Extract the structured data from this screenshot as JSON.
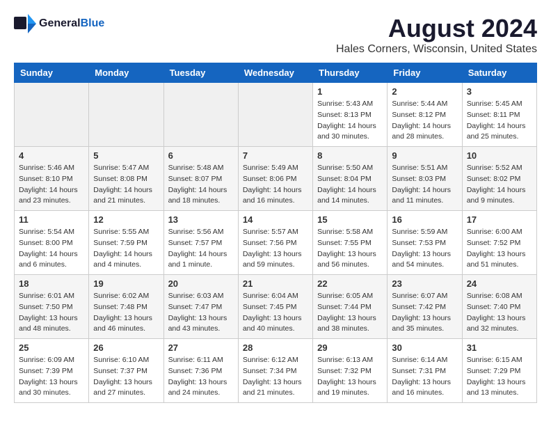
{
  "header": {
    "logo_general": "General",
    "logo_blue": "Blue",
    "month_year": "August 2024",
    "location": "Hales Corners, Wisconsin, United States"
  },
  "columns": [
    "Sunday",
    "Monday",
    "Tuesday",
    "Wednesday",
    "Thursday",
    "Friday",
    "Saturday"
  ],
  "weeks": [
    [
      {
        "empty": true
      },
      {
        "empty": true
      },
      {
        "empty": true
      },
      {
        "empty": true
      },
      {
        "day": "1",
        "sunrise": "5:43 AM",
        "sunset": "8:13 PM",
        "daylight": "14 hours and 30 minutes."
      },
      {
        "day": "2",
        "sunrise": "5:44 AM",
        "sunset": "8:12 PM",
        "daylight": "14 hours and 28 minutes."
      },
      {
        "day": "3",
        "sunrise": "5:45 AM",
        "sunset": "8:11 PM",
        "daylight": "14 hours and 25 minutes."
      }
    ],
    [
      {
        "day": "4",
        "sunrise": "5:46 AM",
        "sunset": "8:10 PM",
        "daylight": "14 hours and 23 minutes."
      },
      {
        "day": "5",
        "sunrise": "5:47 AM",
        "sunset": "8:08 PM",
        "daylight": "14 hours and 21 minutes."
      },
      {
        "day": "6",
        "sunrise": "5:48 AM",
        "sunset": "8:07 PM",
        "daylight": "14 hours and 18 minutes."
      },
      {
        "day": "7",
        "sunrise": "5:49 AM",
        "sunset": "8:06 PM",
        "daylight": "14 hours and 16 minutes."
      },
      {
        "day": "8",
        "sunrise": "5:50 AM",
        "sunset": "8:04 PM",
        "daylight": "14 hours and 14 minutes."
      },
      {
        "day": "9",
        "sunrise": "5:51 AM",
        "sunset": "8:03 PM",
        "daylight": "14 hours and 11 minutes."
      },
      {
        "day": "10",
        "sunrise": "5:52 AM",
        "sunset": "8:02 PM",
        "daylight": "14 hours and 9 minutes."
      }
    ],
    [
      {
        "day": "11",
        "sunrise": "5:54 AM",
        "sunset": "8:00 PM",
        "daylight": "14 hours and 6 minutes."
      },
      {
        "day": "12",
        "sunrise": "5:55 AM",
        "sunset": "7:59 PM",
        "daylight": "14 hours and 4 minutes."
      },
      {
        "day": "13",
        "sunrise": "5:56 AM",
        "sunset": "7:57 PM",
        "daylight": "14 hours and 1 minute."
      },
      {
        "day": "14",
        "sunrise": "5:57 AM",
        "sunset": "7:56 PM",
        "daylight": "13 hours and 59 minutes."
      },
      {
        "day": "15",
        "sunrise": "5:58 AM",
        "sunset": "7:55 PM",
        "daylight": "13 hours and 56 minutes."
      },
      {
        "day": "16",
        "sunrise": "5:59 AM",
        "sunset": "7:53 PM",
        "daylight": "13 hours and 54 minutes."
      },
      {
        "day": "17",
        "sunrise": "6:00 AM",
        "sunset": "7:52 PM",
        "daylight": "13 hours and 51 minutes."
      }
    ],
    [
      {
        "day": "18",
        "sunrise": "6:01 AM",
        "sunset": "7:50 PM",
        "daylight": "13 hours and 48 minutes."
      },
      {
        "day": "19",
        "sunrise": "6:02 AM",
        "sunset": "7:48 PM",
        "daylight": "13 hours and 46 minutes."
      },
      {
        "day": "20",
        "sunrise": "6:03 AM",
        "sunset": "7:47 PM",
        "daylight": "13 hours and 43 minutes."
      },
      {
        "day": "21",
        "sunrise": "6:04 AM",
        "sunset": "7:45 PM",
        "daylight": "13 hours and 40 minutes."
      },
      {
        "day": "22",
        "sunrise": "6:05 AM",
        "sunset": "7:44 PM",
        "daylight": "13 hours and 38 minutes."
      },
      {
        "day": "23",
        "sunrise": "6:07 AM",
        "sunset": "7:42 PM",
        "daylight": "13 hours and 35 minutes."
      },
      {
        "day": "24",
        "sunrise": "6:08 AM",
        "sunset": "7:40 PM",
        "daylight": "13 hours and 32 minutes."
      }
    ],
    [
      {
        "day": "25",
        "sunrise": "6:09 AM",
        "sunset": "7:39 PM",
        "daylight": "13 hours and 30 minutes."
      },
      {
        "day": "26",
        "sunrise": "6:10 AM",
        "sunset": "7:37 PM",
        "daylight": "13 hours and 27 minutes."
      },
      {
        "day": "27",
        "sunrise": "6:11 AM",
        "sunset": "7:36 PM",
        "daylight": "13 hours and 24 minutes."
      },
      {
        "day": "28",
        "sunrise": "6:12 AM",
        "sunset": "7:34 PM",
        "daylight": "13 hours and 21 minutes."
      },
      {
        "day": "29",
        "sunrise": "6:13 AM",
        "sunset": "7:32 PM",
        "daylight": "13 hours and 19 minutes."
      },
      {
        "day": "30",
        "sunrise": "6:14 AM",
        "sunset": "7:31 PM",
        "daylight": "13 hours and 16 minutes."
      },
      {
        "day": "31",
        "sunrise": "6:15 AM",
        "sunset": "7:29 PM",
        "daylight": "13 hours and 13 minutes."
      }
    ]
  ]
}
